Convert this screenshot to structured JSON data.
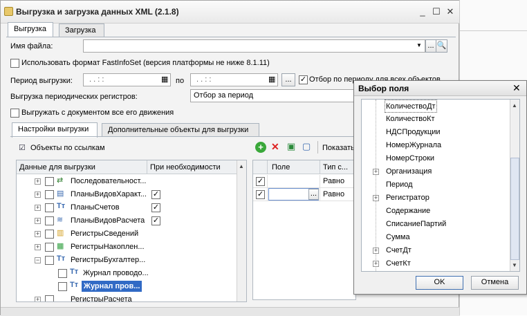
{
  "window": {
    "title": "Выгрузка и загрузка данных XML (2.1.8)"
  },
  "tabs": [
    "Выгрузка",
    "Загрузка"
  ],
  "form": {
    "filename_label": "Имя файла:",
    "fastinfoset_label": "Использовать формат FastInfoSet (версия платформы не ниже 8.1.11)",
    "period_label": "Период выгрузки:",
    "period_from": ".   .       :  :",
    "period_to_label": "по",
    "period_to": ".   .       :  :",
    "filter_label": "Отбор по периоду для всех объектов",
    "periodic_label": "Выгрузка периодических регистров:",
    "periodic_value": "Отбор за период",
    "with_movements_label": "Выгружать с документом все его движения"
  },
  "subtabs": [
    "Настройки выгрузки",
    "Дополнительные объекты для выгрузки"
  ],
  "left_panel": {
    "objects_by_ref": "Объекты по ссылкам",
    "col_data": "Данные для выгрузки",
    "col_when_needed": "При необходимости",
    "rows": [
      {
        "label": "Последовательност...",
        "checked": false,
        "needed": false
      },
      {
        "label": "ПланыВидовХаракт...",
        "checked": false,
        "needed": true
      },
      {
        "label": "ПланыСчетов",
        "checked": false,
        "needed": true
      },
      {
        "label": "ПланыВидовРасчета",
        "checked": false,
        "needed": true
      },
      {
        "label": "РегистрыСведений",
        "checked": false,
        "needed": false
      },
      {
        "label": "РегистрыНакоплен...",
        "checked": false,
        "needed": false
      },
      {
        "label": "РегистрыБухгалтер...",
        "checked": false,
        "needed": false
      },
      {
        "label": "Журнал проводо...",
        "checked": false,
        "needed": false
      },
      {
        "label": "Журнал пров...",
        "checked": false,
        "needed": false
      },
      {
        "label": "РегистрыРасчета",
        "checked": false,
        "needed": false
      }
    ]
  },
  "right_panel": {
    "show_label": "Показать",
    "col_field": "Поле",
    "col_type": "Тип с...",
    "rows": [
      {
        "checked": true,
        "type": "Равно"
      },
      {
        "checked": true,
        "type": "Равно"
      }
    ]
  },
  "dialog": {
    "title": "Выбор поля",
    "items": [
      {
        "label": "КоличествоДт",
        "expandable": false
      },
      {
        "label": "КоличествоКт",
        "expandable": false
      },
      {
        "label": "НДСПродукции",
        "expandable": false
      },
      {
        "label": "НомерЖурнала",
        "expandable": false
      },
      {
        "label": "НомерСтроки",
        "expandable": false
      },
      {
        "label": "Организация",
        "expandable": true
      },
      {
        "label": "Период",
        "expandable": false
      },
      {
        "label": "Регистратор",
        "expandable": true
      },
      {
        "label": "Содержание",
        "expandable": false
      },
      {
        "label": "СписаниеПартий",
        "expandable": false
      },
      {
        "label": "Сумма",
        "expandable": false
      },
      {
        "label": "СчетДт",
        "expandable": true
      },
      {
        "label": "СчетКт",
        "expandable": true
      }
    ],
    "ok": "OK",
    "cancel": "Отмена"
  },
  "colors": {
    "accent": "#316ac5",
    "title_bg": "#ececec"
  }
}
